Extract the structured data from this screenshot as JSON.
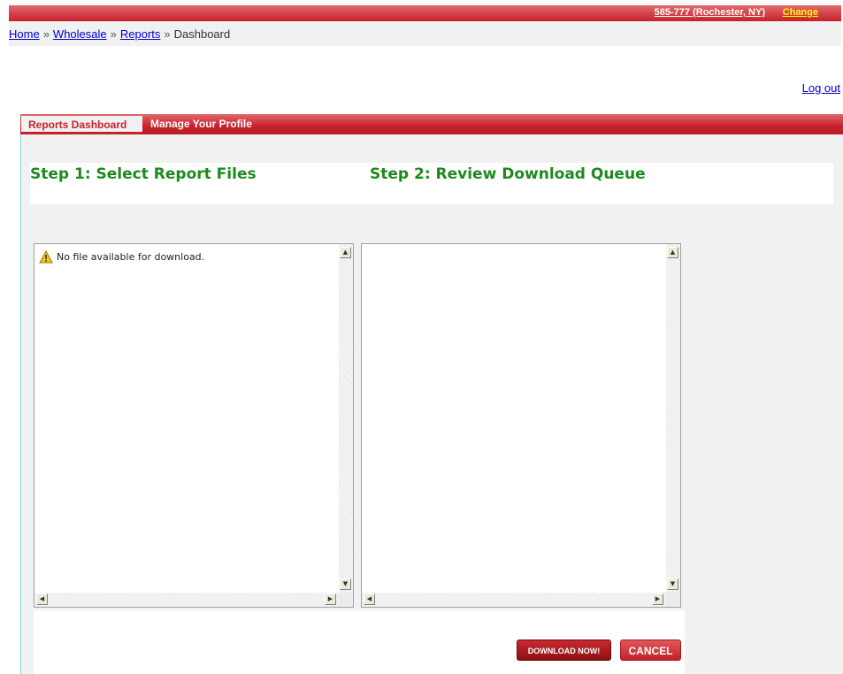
{
  "header": {
    "area_code": "585-777 (Rochester, NY)",
    "change_label": "Change"
  },
  "breadcrumb": {
    "home": "Home",
    "wholesale": "Wholesale",
    "reports": "Reports",
    "current": "Dashboard",
    "separator": "»"
  },
  "logout_label": "Log out",
  "tabs": [
    {
      "label": "Reports Dashboard",
      "active": true
    },
    {
      "label": "Manage Your Profile",
      "active": false
    }
  ],
  "steps": {
    "step1": "Step 1: Select Report Files",
    "step2": "Step 2: Review Download Queue"
  },
  "file_list": {
    "empty_message": "No file available for download.",
    "icon": "warning-icon"
  },
  "download_queue": {
    "items": []
  },
  "buttons": {
    "download": "DOWNLOAD NOW!",
    "cancel": "CANCEL"
  },
  "colors": {
    "brand_red": "#c8202c",
    "step_green": "#1d8a1d",
    "link_blue": "#0000cc",
    "change_yellow": "#ffff00"
  }
}
